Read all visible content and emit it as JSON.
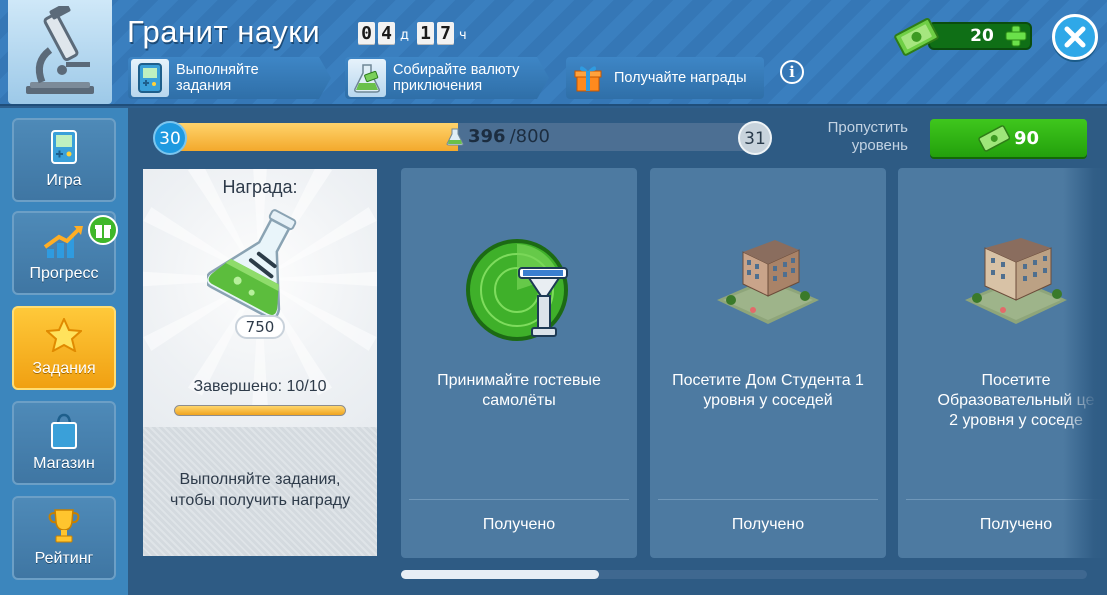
{
  "header": {
    "title": "Гранит науки",
    "timer": {
      "days_digits": [
        "0",
        "4"
      ],
      "days_unit": "д",
      "hours_digits": [
        "1",
        "7"
      ],
      "hours_unit": "ч"
    },
    "chips": [
      {
        "label": "Выполняйте\nзадания",
        "icon": "gameboy-icon"
      },
      {
        "label": "Собирайте валюту\nприключения",
        "icon": "flask-cash-icon"
      },
      {
        "label": "Получайте награды",
        "icon": "gift-icon"
      }
    ],
    "info_icon": "i",
    "currency": {
      "value": "20",
      "icon": "cash-icon"
    },
    "close_icon": "close-icon"
  },
  "sidebar": {
    "items": [
      {
        "label": "Игра",
        "icon": "gameboy-icon",
        "active": false
      },
      {
        "label": "Прогресс",
        "icon": "growth-chart-icon",
        "active": false,
        "badge": "gift-icon"
      },
      {
        "label": "Задания",
        "icon": "star-icon",
        "active": true
      },
      {
        "label": "Магазин",
        "icon": "shopping-bag-icon",
        "active": false
      },
      {
        "label": "Рейтинг",
        "icon": "trophy-icon",
        "active": false
      }
    ]
  },
  "progress": {
    "current_level": "30",
    "next_level": "31",
    "current": "396",
    "max": "/800",
    "fraction": 0.495,
    "skip_label": "Пропустить\nуровень",
    "skip_cost": "90"
  },
  "reward": {
    "title": "Награда:",
    "amount": "750",
    "completed": "Завершено: 10/10",
    "completed_fraction": 1.0,
    "hint": "Выполняйте задания,\nчтобы получить награду"
  },
  "tasks": [
    {
      "desc": "Принимайте гостевые\nсамолёты",
      "status": "Получено",
      "icon": "radar-tower-icon"
    },
    {
      "desc": "Посетите Дом Студента 1\nуровня у соседей",
      "status": "Получено",
      "icon": "building-icon"
    },
    {
      "desc": "Посетите\nОбразовательный це\n2 уровня у соседе",
      "status": "Получено",
      "icon": "building-icon"
    }
  ],
  "colors": {
    "header": "#3a7fbf",
    "main_bg": "#2e5b84",
    "card": "#4d7aa1",
    "accent_orange": "#f3a92c",
    "accent_green": "#23a00c"
  }
}
